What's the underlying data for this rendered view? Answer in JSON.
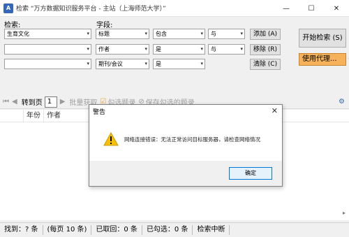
{
  "window": {
    "icon_text": "A",
    "title": "检索 “万方数据知识服务平台 - 主站（上海师范大学）”",
    "minimize": "—",
    "maximize": "☐",
    "close": "✕"
  },
  "search": {
    "keyword_label": "检索:",
    "field_label": "字段:",
    "rows": [
      {
        "keyword": "生育文化",
        "field": "标题",
        "match": "包含",
        "logic": "与"
      },
      {
        "keyword": "",
        "field": "作者",
        "match": "是",
        "logic": "与"
      },
      {
        "keyword": "",
        "field": "期刊/会议",
        "match": "是",
        "logic": ""
      }
    ],
    "add_button": "添加 (A)",
    "remove_button": "移除 (R)",
    "clear_button": "清除 (C)",
    "start_button": "开始检索 (S)",
    "proxy_button": "使用代理..."
  },
  "toolbar": {
    "goto_label": "转到页",
    "page_value": "1",
    "batch_label": "批量获取",
    "check_label": "勾选题录",
    "save_label": "保存勾选的题录"
  },
  "results": {
    "columns": [
      "年份",
      "作者"
    ]
  },
  "status": {
    "found": "找到：? 条",
    "per_page": "(每页 10 条)",
    "fetched": "已取回：0 条",
    "checked": "已勾选：0 条",
    "state": "检索中断"
  },
  "dialog": {
    "title": "警告",
    "close": "✕",
    "message": "网络连接错误：无法正常访问目标服务器，请检查网络情况",
    "ok_button": "确定"
  }
}
